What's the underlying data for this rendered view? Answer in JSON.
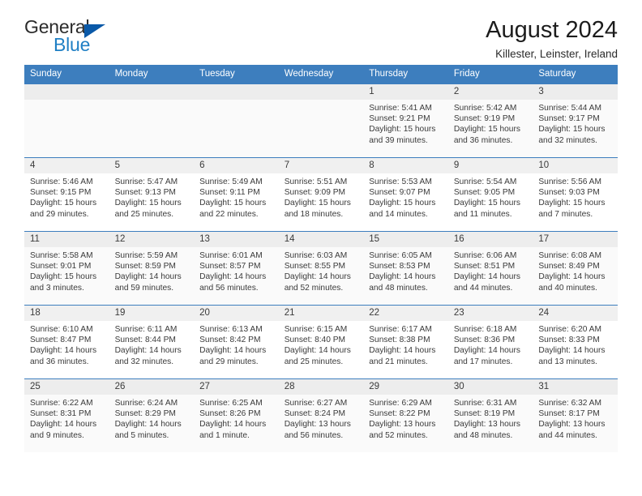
{
  "brand": {
    "name_part1": "General",
    "name_part2": "Blue",
    "triangle_color": "#0a59a8",
    "blue_color": "#1f7fc4"
  },
  "header": {
    "title": "August 2024",
    "subtitle": "Killester, Leinster, Ireland",
    "accent_color": "#3d7ebe"
  },
  "calendar": {
    "weekday_headers": [
      "Sunday",
      "Monday",
      "Tuesday",
      "Wednesday",
      "Thursday",
      "Friday",
      "Saturday"
    ],
    "labels": {
      "sunrise": "Sunrise:",
      "sunset": "Sunset:",
      "daylight": "Daylight:"
    },
    "weeks": [
      [
        {
          "day": "",
          "blank": true
        },
        {
          "day": "",
          "blank": true
        },
        {
          "day": "",
          "blank": true
        },
        {
          "day": "",
          "blank": true
        },
        {
          "day": "1",
          "sunrise": "Sunrise: 5:41 AM",
          "sunset": "Sunset: 9:21 PM",
          "daylight_l1": "Daylight: 15 hours",
          "daylight_l2": "and 39 minutes."
        },
        {
          "day": "2",
          "sunrise": "Sunrise: 5:42 AM",
          "sunset": "Sunset: 9:19 PM",
          "daylight_l1": "Daylight: 15 hours",
          "daylight_l2": "and 36 minutes."
        },
        {
          "day": "3",
          "sunrise": "Sunrise: 5:44 AM",
          "sunset": "Sunset: 9:17 PM",
          "daylight_l1": "Daylight: 15 hours",
          "daylight_l2": "and 32 minutes."
        }
      ],
      [
        {
          "day": "4",
          "sunrise": "Sunrise: 5:46 AM",
          "sunset": "Sunset: 9:15 PM",
          "daylight_l1": "Daylight: 15 hours",
          "daylight_l2": "and 29 minutes."
        },
        {
          "day": "5",
          "sunrise": "Sunrise: 5:47 AM",
          "sunset": "Sunset: 9:13 PM",
          "daylight_l1": "Daylight: 15 hours",
          "daylight_l2": "and 25 minutes."
        },
        {
          "day": "6",
          "sunrise": "Sunrise: 5:49 AM",
          "sunset": "Sunset: 9:11 PM",
          "daylight_l1": "Daylight: 15 hours",
          "daylight_l2": "and 22 minutes."
        },
        {
          "day": "7",
          "sunrise": "Sunrise: 5:51 AM",
          "sunset": "Sunset: 9:09 PM",
          "daylight_l1": "Daylight: 15 hours",
          "daylight_l2": "and 18 minutes."
        },
        {
          "day": "8",
          "sunrise": "Sunrise: 5:53 AM",
          "sunset": "Sunset: 9:07 PM",
          "daylight_l1": "Daylight: 15 hours",
          "daylight_l2": "and 14 minutes."
        },
        {
          "day": "9",
          "sunrise": "Sunrise: 5:54 AM",
          "sunset": "Sunset: 9:05 PM",
          "daylight_l1": "Daylight: 15 hours",
          "daylight_l2": "and 11 minutes."
        },
        {
          "day": "10",
          "sunrise": "Sunrise: 5:56 AM",
          "sunset": "Sunset: 9:03 PM",
          "daylight_l1": "Daylight: 15 hours",
          "daylight_l2": "and 7 minutes."
        }
      ],
      [
        {
          "day": "11",
          "sunrise": "Sunrise: 5:58 AM",
          "sunset": "Sunset: 9:01 PM",
          "daylight_l1": "Daylight: 15 hours",
          "daylight_l2": "and 3 minutes."
        },
        {
          "day": "12",
          "sunrise": "Sunrise: 5:59 AM",
          "sunset": "Sunset: 8:59 PM",
          "daylight_l1": "Daylight: 14 hours",
          "daylight_l2": "and 59 minutes."
        },
        {
          "day": "13",
          "sunrise": "Sunrise: 6:01 AM",
          "sunset": "Sunset: 8:57 PM",
          "daylight_l1": "Daylight: 14 hours",
          "daylight_l2": "and 56 minutes."
        },
        {
          "day": "14",
          "sunrise": "Sunrise: 6:03 AM",
          "sunset": "Sunset: 8:55 PM",
          "daylight_l1": "Daylight: 14 hours",
          "daylight_l2": "and 52 minutes."
        },
        {
          "day": "15",
          "sunrise": "Sunrise: 6:05 AM",
          "sunset": "Sunset: 8:53 PM",
          "daylight_l1": "Daylight: 14 hours",
          "daylight_l2": "and 48 minutes."
        },
        {
          "day": "16",
          "sunrise": "Sunrise: 6:06 AM",
          "sunset": "Sunset: 8:51 PM",
          "daylight_l1": "Daylight: 14 hours",
          "daylight_l2": "and 44 minutes."
        },
        {
          "day": "17",
          "sunrise": "Sunrise: 6:08 AM",
          "sunset": "Sunset: 8:49 PM",
          "daylight_l1": "Daylight: 14 hours",
          "daylight_l2": "and 40 minutes."
        }
      ],
      [
        {
          "day": "18",
          "sunrise": "Sunrise: 6:10 AM",
          "sunset": "Sunset: 8:47 PM",
          "daylight_l1": "Daylight: 14 hours",
          "daylight_l2": "and 36 minutes."
        },
        {
          "day": "19",
          "sunrise": "Sunrise: 6:11 AM",
          "sunset": "Sunset: 8:44 PM",
          "daylight_l1": "Daylight: 14 hours",
          "daylight_l2": "and 32 minutes."
        },
        {
          "day": "20",
          "sunrise": "Sunrise: 6:13 AM",
          "sunset": "Sunset: 8:42 PM",
          "daylight_l1": "Daylight: 14 hours",
          "daylight_l2": "and 29 minutes."
        },
        {
          "day": "21",
          "sunrise": "Sunrise: 6:15 AM",
          "sunset": "Sunset: 8:40 PM",
          "daylight_l1": "Daylight: 14 hours",
          "daylight_l2": "and 25 minutes."
        },
        {
          "day": "22",
          "sunrise": "Sunrise: 6:17 AM",
          "sunset": "Sunset: 8:38 PM",
          "daylight_l1": "Daylight: 14 hours",
          "daylight_l2": "and 21 minutes."
        },
        {
          "day": "23",
          "sunrise": "Sunrise: 6:18 AM",
          "sunset": "Sunset: 8:36 PM",
          "daylight_l1": "Daylight: 14 hours",
          "daylight_l2": "and 17 minutes."
        },
        {
          "day": "24",
          "sunrise": "Sunrise: 6:20 AM",
          "sunset": "Sunset: 8:33 PM",
          "daylight_l1": "Daylight: 14 hours",
          "daylight_l2": "and 13 minutes."
        }
      ],
      [
        {
          "day": "25",
          "sunrise": "Sunrise: 6:22 AM",
          "sunset": "Sunset: 8:31 PM",
          "daylight_l1": "Daylight: 14 hours",
          "daylight_l2": "and 9 minutes."
        },
        {
          "day": "26",
          "sunrise": "Sunrise: 6:24 AM",
          "sunset": "Sunset: 8:29 PM",
          "daylight_l1": "Daylight: 14 hours",
          "daylight_l2": "and 5 minutes."
        },
        {
          "day": "27",
          "sunrise": "Sunrise: 6:25 AM",
          "sunset": "Sunset: 8:26 PM",
          "daylight_l1": "Daylight: 14 hours",
          "daylight_l2": "and 1 minute."
        },
        {
          "day": "28",
          "sunrise": "Sunrise: 6:27 AM",
          "sunset": "Sunset: 8:24 PM",
          "daylight_l1": "Daylight: 13 hours",
          "daylight_l2": "and 56 minutes."
        },
        {
          "day": "29",
          "sunrise": "Sunrise: 6:29 AM",
          "sunset": "Sunset: 8:22 PM",
          "daylight_l1": "Daylight: 13 hours",
          "daylight_l2": "and 52 minutes."
        },
        {
          "day": "30",
          "sunrise": "Sunrise: 6:31 AM",
          "sunset": "Sunset: 8:19 PM",
          "daylight_l1": "Daylight: 13 hours",
          "daylight_l2": "and 48 minutes."
        },
        {
          "day": "31",
          "sunrise": "Sunrise: 6:32 AM",
          "sunset": "Sunset: 8:17 PM",
          "daylight_l1": "Daylight: 13 hours",
          "daylight_l2": "and 44 minutes."
        }
      ]
    ]
  }
}
